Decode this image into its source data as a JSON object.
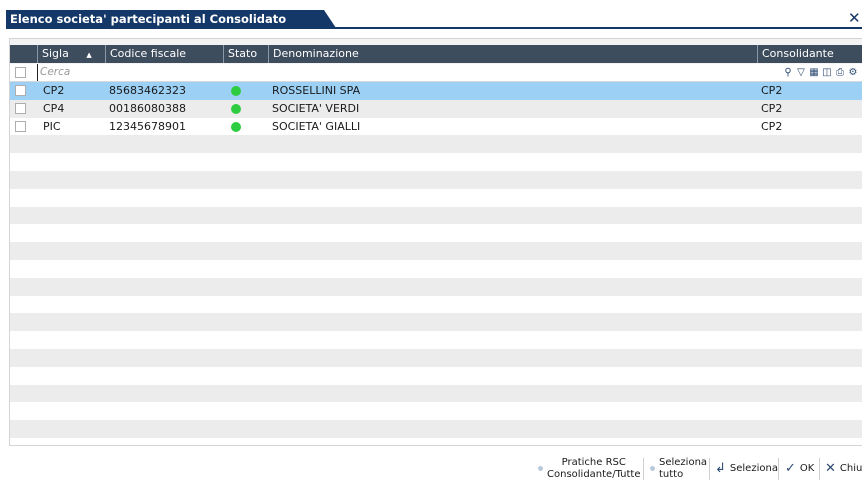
{
  "window": {
    "title": "Elenco societa' partecipanti al Consolidato Nazionale",
    "close_glyph": "✕"
  },
  "columns": {
    "sigla": "Sigla",
    "sort_indicator": "▲",
    "codice_fiscale": "Codice fiscale",
    "stato": "Stato",
    "denominazione": "Denominazione",
    "consolidante": "Consolidante"
  },
  "search": {
    "placeholder": "Cerca"
  },
  "toolbar_icons": [
    "search-icon",
    "filter-icon",
    "export-icon",
    "columns-icon",
    "print-icon",
    "settings-icon"
  ],
  "rows": [
    {
      "sigla": "CP2",
      "codice_fiscale": "85683462323",
      "stato": "active",
      "denominazione": "ROSSELLINI SPA",
      "consolidante": "CP2"
    },
    {
      "sigla": "CP4",
      "codice_fiscale": "00186080388",
      "stato": "active",
      "denominazione": "SOCIETA' VERDI",
      "consolidante": "CP2"
    },
    {
      "sigla": "PIC",
      "codice_fiscale": "12345678901",
      "stato": "active",
      "denominazione": "SOCIETA' GIALLI",
      "consolidante": "CP2"
    }
  ],
  "footer": {
    "pratiche_line1": "Pratiche RSC",
    "pratiche_line2": "Consolidante/Tutte",
    "seleziona_tutto_line1": "Seleziona",
    "seleziona_tutto_line2": "tutto",
    "seleziona": "Seleziona",
    "ok": "OK",
    "chiudi": "Chiudi"
  },
  "colors": {
    "title_bg": "#143868",
    "header_bg": "#3e4d5e",
    "selected_row": "#9cd0f5",
    "status_active": "#2ecc40"
  }
}
